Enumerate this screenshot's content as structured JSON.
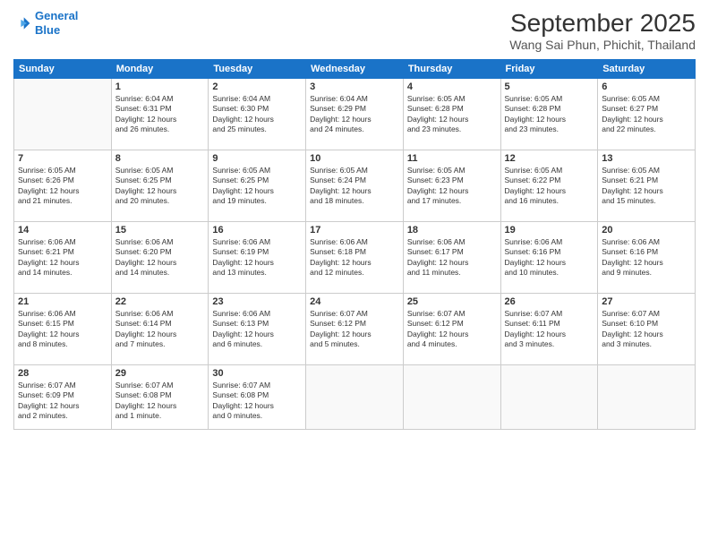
{
  "header": {
    "logo_line1": "General",
    "logo_line2": "Blue",
    "month": "September 2025",
    "location": "Wang Sai Phun, Phichit, Thailand"
  },
  "days_of_week": [
    "Sunday",
    "Monday",
    "Tuesday",
    "Wednesday",
    "Thursday",
    "Friday",
    "Saturday"
  ],
  "weeks": [
    [
      {
        "day": "",
        "info": ""
      },
      {
        "day": "1",
        "info": "Sunrise: 6:04 AM\nSunset: 6:31 PM\nDaylight: 12 hours\nand 26 minutes."
      },
      {
        "day": "2",
        "info": "Sunrise: 6:04 AM\nSunset: 6:30 PM\nDaylight: 12 hours\nand 25 minutes."
      },
      {
        "day": "3",
        "info": "Sunrise: 6:04 AM\nSunset: 6:29 PM\nDaylight: 12 hours\nand 24 minutes."
      },
      {
        "day": "4",
        "info": "Sunrise: 6:05 AM\nSunset: 6:28 PM\nDaylight: 12 hours\nand 23 minutes."
      },
      {
        "day": "5",
        "info": "Sunrise: 6:05 AM\nSunset: 6:28 PM\nDaylight: 12 hours\nand 23 minutes."
      },
      {
        "day": "6",
        "info": "Sunrise: 6:05 AM\nSunset: 6:27 PM\nDaylight: 12 hours\nand 22 minutes."
      }
    ],
    [
      {
        "day": "7",
        "info": "Sunrise: 6:05 AM\nSunset: 6:26 PM\nDaylight: 12 hours\nand 21 minutes."
      },
      {
        "day": "8",
        "info": "Sunrise: 6:05 AM\nSunset: 6:25 PM\nDaylight: 12 hours\nand 20 minutes."
      },
      {
        "day": "9",
        "info": "Sunrise: 6:05 AM\nSunset: 6:25 PM\nDaylight: 12 hours\nand 19 minutes."
      },
      {
        "day": "10",
        "info": "Sunrise: 6:05 AM\nSunset: 6:24 PM\nDaylight: 12 hours\nand 18 minutes."
      },
      {
        "day": "11",
        "info": "Sunrise: 6:05 AM\nSunset: 6:23 PM\nDaylight: 12 hours\nand 17 minutes."
      },
      {
        "day": "12",
        "info": "Sunrise: 6:05 AM\nSunset: 6:22 PM\nDaylight: 12 hours\nand 16 minutes."
      },
      {
        "day": "13",
        "info": "Sunrise: 6:05 AM\nSunset: 6:21 PM\nDaylight: 12 hours\nand 15 minutes."
      }
    ],
    [
      {
        "day": "14",
        "info": "Sunrise: 6:06 AM\nSunset: 6:21 PM\nDaylight: 12 hours\nand 14 minutes."
      },
      {
        "day": "15",
        "info": "Sunrise: 6:06 AM\nSunset: 6:20 PM\nDaylight: 12 hours\nand 14 minutes."
      },
      {
        "day": "16",
        "info": "Sunrise: 6:06 AM\nSunset: 6:19 PM\nDaylight: 12 hours\nand 13 minutes."
      },
      {
        "day": "17",
        "info": "Sunrise: 6:06 AM\nSunset: 6:18 PM\nDaylight: 12 hours\nand 12 minutes."
      },
      {
        "day": "18",
        "info": "Sunrise: 6:06 AM\nSunset: 6:17 PM\nDaylight: 12 hours\nand 11 minutes."
      },
      {
        "day": "19",
        "info": "Sunrise: 6:06 AM\nSunset: 6:16 PM\nDaylight: 12 hours\nand 10 minutes."
      },
      {
        "day": "20",
        "info": "Sunrise: 6:06 AM\nSunset: 6:16 PM\nDaylight: 12 hours\nand 9 minutes."
      }
    ],
    [
      {
        "day": "21",
        "info": "Sunrise: 6:06 AM\nSunset: 6:15 PM\nDaylight: 12 hours\nand 8 minutes."
      },
      {
        "day": "22",
        "info": "Sunrise: 6:06 AM\nSunset: 6:14 PM\nDaylight: 12 hours\nand 7 minutes."
      },
      {
        "day": "23",
        "info": "Sunrise: 6:06 AM\nSunset: 6:13 PM\nDaylight: 12 hours\nand 6 minutes."
      },
      {
        "day": "24",
        "info": "Sunrise: 6:07 AM\nSunset: 6:12 PM\nDaylight: 12 hours\nand 5 minutes."
      },
      {
        "day": "25",
        "info": "Sunrise: 6:07 AM\nSunset: 6:12 PM\nDaylight: 12 hours\nand 4 minutes."
      },
      {
        "day": "26",
        "info": "Sunrise: 6:07 AM\nSunset: 6:11 PM\nDaylight: 12 hours\nand 3 minutes."
      },
      {
        "day": "27",
        "info": "Sunrise: 6:07 AM\nSunset: 6:10 PM\nDaylight: 12 hours\nand 3 minutes."
      }
    ],
    [
      {
        "day": "28",
        "info": "Sunrise: 6:07 AM\nSunset: 6:09 PM\nDaylight: 12 hours\nand 2 minutes."
      },
      {
        "day": "29",
        "info": "Sunrise: 6:07 AM\nSunset: 6:08 PM\nDaylight: 12 hours\nand 1 minute."
      },
      {
        "day": "30",
        "info": "Sunrise: 6:07 AM\nSunset: 6:08 PM\nDaylight: 12 hours\nand 0 minutes."
      },
      {
        "day": "",
        "info": ""
      },
      {
        "day": "",
        "info": ""
      },
      {
        "day": "",
        "info": ""
      },
      {
        "day": "",
        "info": ""
      }
    ]
  ]
}
